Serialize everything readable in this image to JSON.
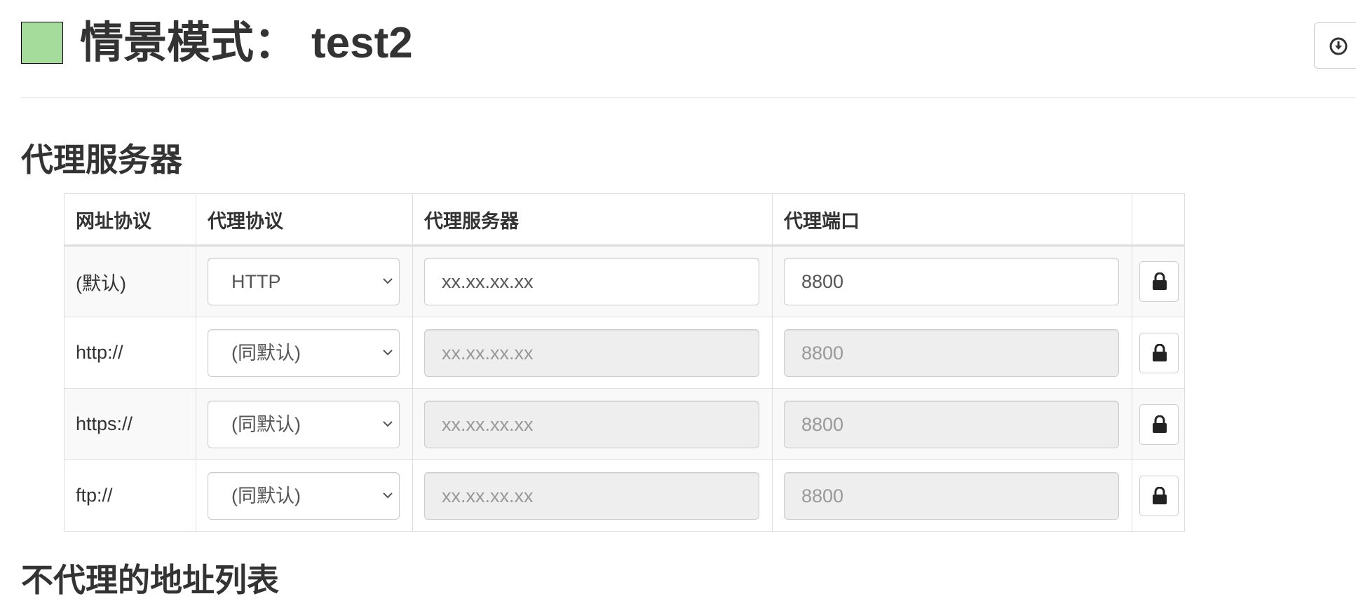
{
  "header": {
    "swatch_color": "#a6dc9b",
    "title_label": "情景模式：",
    "profile_name": "test2",
    "action_icon": "download-circle-icon"
  },
  "sections": {
    "proxy_servers": "代理服务器",
    "bypass_list": "不代理的地址列表"
  },
  "table": {
    "headers": [
      "网址协议",
      "代理协议",
      "代理服务器",
      "代理端口",
      ""
    ],
    "rows": [
      {
        "scheme": "(默认)",
        "protocol": "HTTP",
        "server": "xx.xx.xx.xx",
        "port": "8800",
        "disabled": false,
        "lock_icon": "lock-icon"
      },
      {
        "scheme": "http://",
        "protocol": "(同默认)",
        "server": "xx.xx.xx.xx",
        "port": "8800",
        "disabled": true,
        "lock_icon": "lock-icon"
      },
      {
        "scheme": "https://",
        "protocol": "(同默认)",
        "server": "xx.xx.xx.xx",
        "port": "8800",
        "disabled": true,
        "lock_icon": "lock-icon"
      },
      {
        "scheme": "ftp://",
        "protocol": "(同默认)",
        "server": "xx.xx.xx.xx",
        "port": "8800",
        "disabled": true,
        "lock_icon": "lock-icon"
      }
    ]
  }
}
